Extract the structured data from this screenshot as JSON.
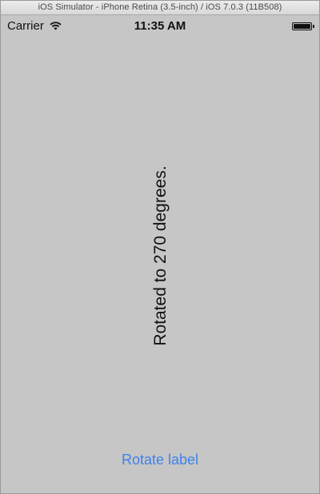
{
  "window": {
    "title": "iOS Simulator - iPhone Retina (3.5-inch) / iOS 7.0.3 (11B508)"
  },
  "status_bar": {
    "carrier": "Carrier",
    "time": "11:35 AM",
    "wifi_icon": "wifi-icon",
    "battery_icon": "battery-icon",
    "battery_level": 1.0
  },
  "main": {
    "label_text": "Rotated to 270 degrees.",
    "button_label": "Rotate label"
  },
  "colors": {
    "background": "#c6c6c6",
    "button_tint": "#3f82ec",
    "text": "#111111"
  }
}
